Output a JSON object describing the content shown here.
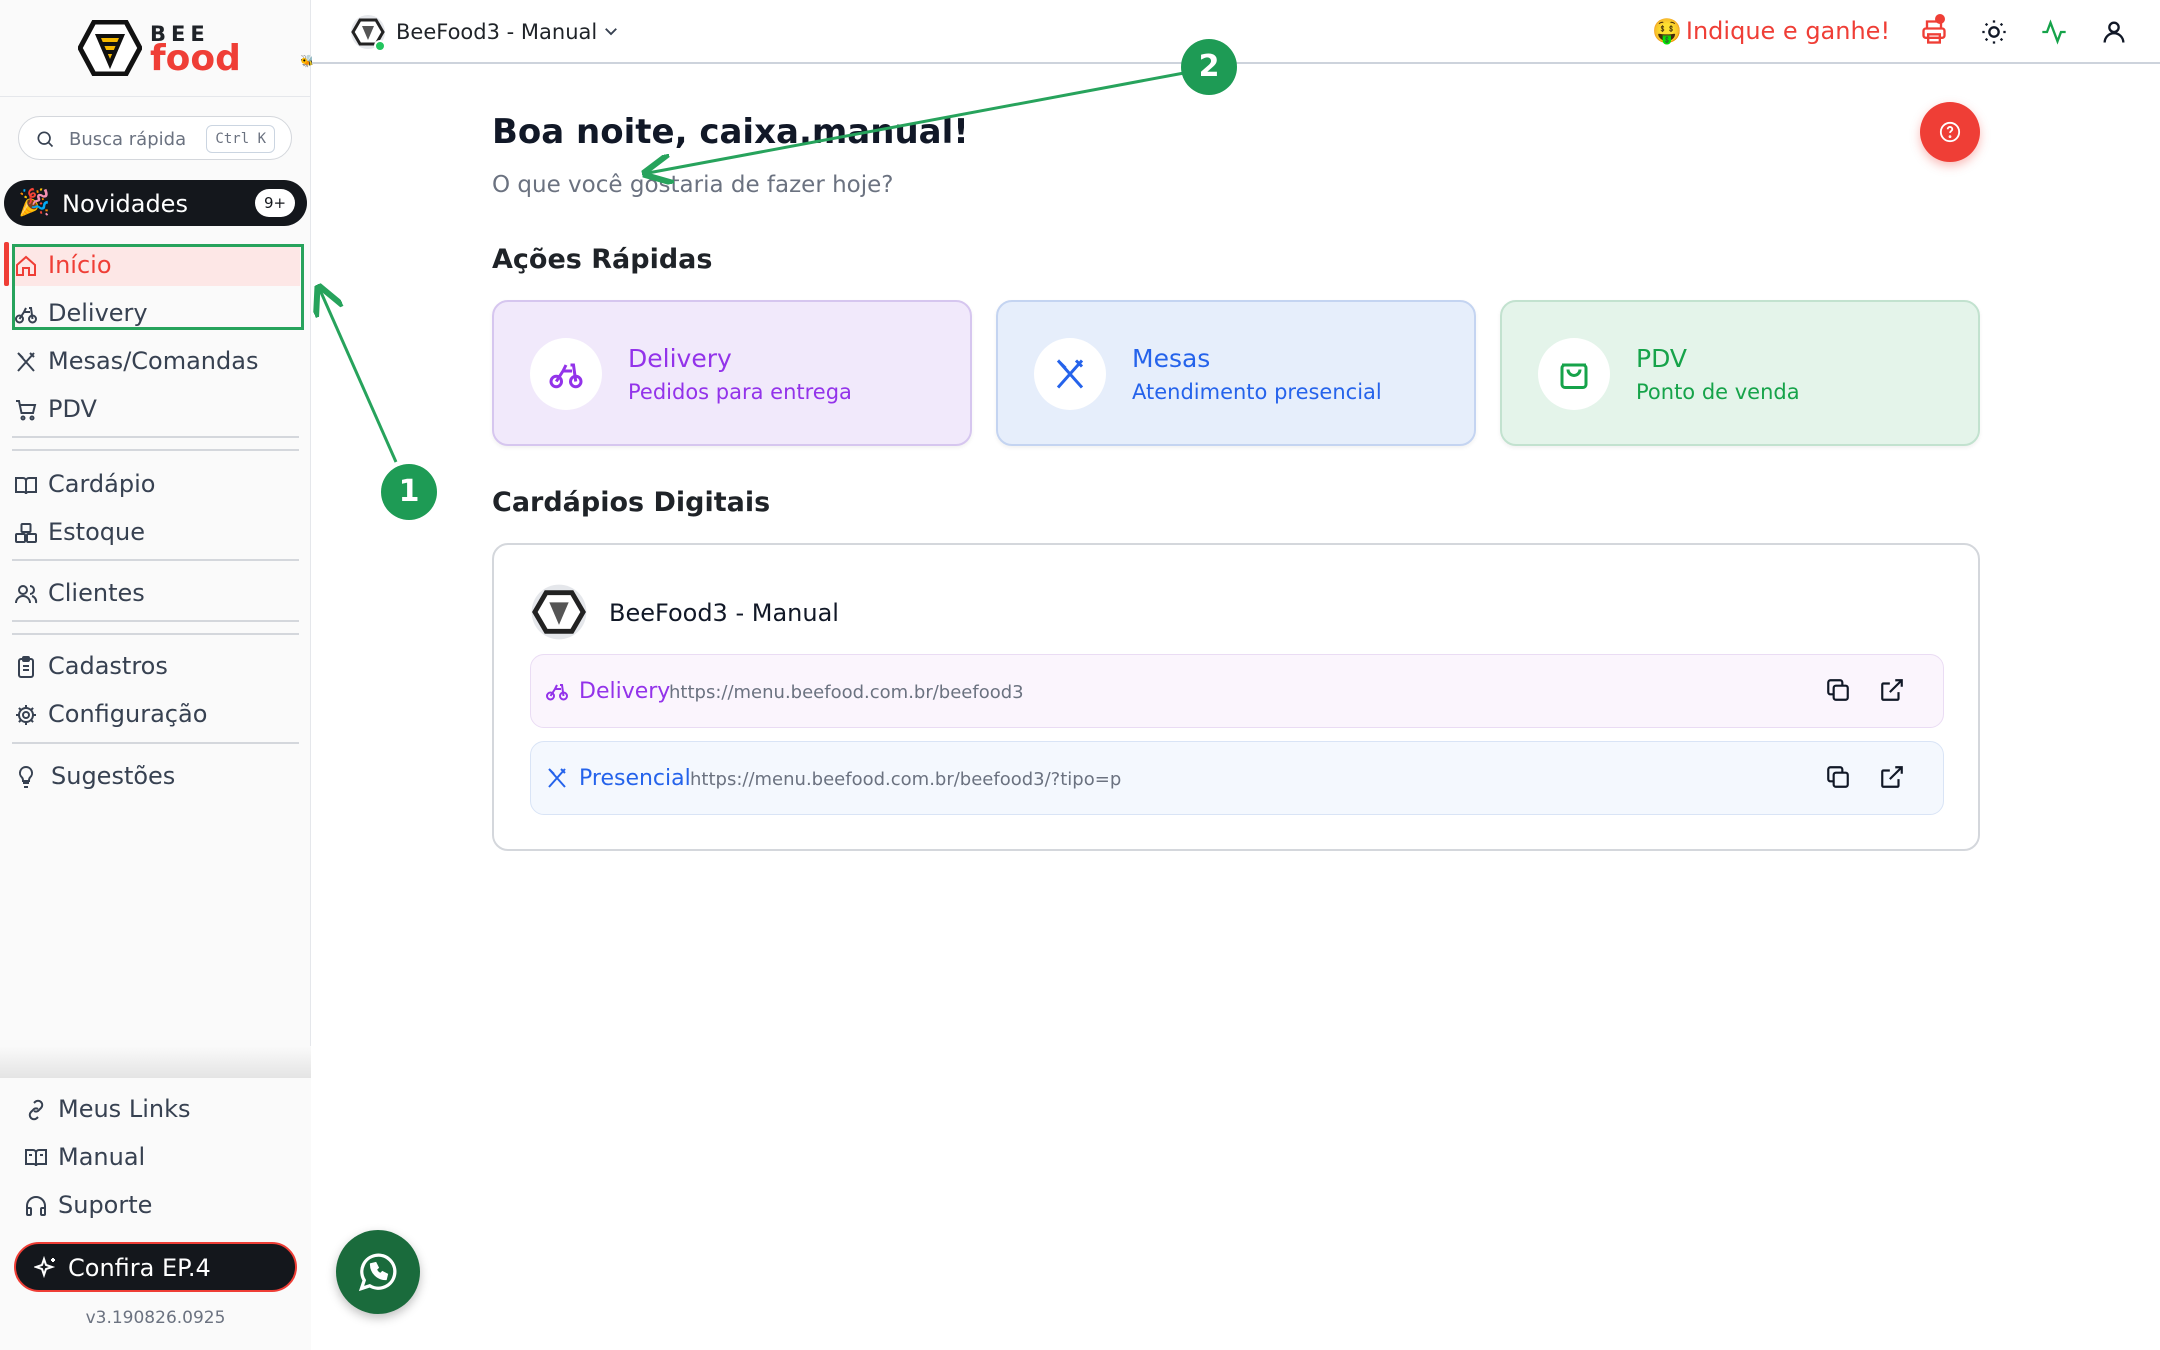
{
  "brand": {
    "top": "BEE",
    "bottom": "food"
  },
  "search": {
    "placeholder": "Busca rápida",
    "shortcut": "Ctrl K"
  },
  "novidades": {
    "label": "Novidades",
    "badge": "9+"
  },
  "sidebar": {
    "items": [
      {
        "label": "Início",
        "icon": "home-icon",
        "active": true
      },
      {
        "label": "Delivery",
        "icon": "bicycle-icon"
      },
      {
        "label": "Mesas/Comandas",
        "icon": "utensils-icon"
      },
      {
        "label": "PDV",
        "icon": "cart-icon"
      },
      {
        "label": "Cardápio",
        "icon": "book-open-icon"
      },
      {
        "label": "Estoque",
        "icon": "boxes-icon"
      },
      {
        "label": "Clientes",
        "icon": "users-icon"
      },
      {
        "label": "Cadastros",
        "icon": "clipboard-icon"
      },
      {
        "label": "Configuração",
        "icon": "gear-icon"
      },
      {
        "label": "Sugestões",
        "icon": "lightbulb-icon"
      }
    ],
    "bottom": [
      {
        "label": "Meus Links",
        "icon": "link-icon"
      },
      {
        "label": "Manual",
        "icon": "book-icon"
      },
      {
        "label": "Suporte",
        "icon": "headphones-icon"
      }
    ],
    "confira": "Confira EP.4",
    "version": "v3.190826.0925"
  },
  "topbar": {
    "store": "BeeFood3 - Manual",
    "indique_emoji": "🤑",
    "indique": "Indique e ganhe!",
    "icons": [
      "printer-icon",
      "sun-icon",
      "activity-icon",
      "user-icon"
    ]
  },
  "main": {
    "greeting": "Boa noite, caixa.manual!",
    "subtitle": "O que você gostaria de fazer hoje?",
    "quick_title": "Ações Rápidas",
    "quick": [
      {
        "title": "Delivery",
        "subtitle": "Pedidos para entrega"
      },
      {
        "title": "Mesas",
        "subtitle": "Atendimento presencial"
      },
      {
        "title": "PDV",
        "subtitle": "Ponto de venda"
      }
    ],
    "menus_title": "Cardápios Digitais",
    "menu_store": "BeeFood3 - Manual",
    "links": [
      {
        "label": "Delivery",
        "url": "https://menu.beefood.com.br/beefood3"
      },
      {
        "label": "Presencial",
        "url": "https://menu.beefood.com.br/beefood3/?tipo=p"
      }
    ]
  },
  "annotations": {
    "one": "1",
    "two": "2"
  },
  "colors": {
    "accent": "#ef3e36",
    "delivery": "#9333ea",
    "mesas": "#2563eb",
    "pdv": "#16a34a",
    "annotation": "#1e9b55"
  }
}
